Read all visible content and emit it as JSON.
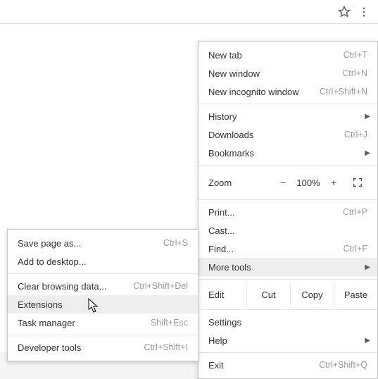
{
  "toolbar": {
    "star_icon": "star-icon",
    "menu_icon": "kebab-menu-icon"
  },
  "menu": {
    "new_tab": {
      "label": "New tab",
      "shortcut": "Ctrl+T"
    },
    "new_window": {
      "label": "New window",
      "shortcut": "Ctrl+N"
    },
    "new_incognito": {
      "label": "New incognito window",
      "shortcut": "Ctrl+Shift+N"
    },
    "history": {
      "label": "History"
    },
    "downloads": {
      "label": "Downloads",
      "shortcut": "Ctrl+J"
    },
    "bookmarks": {
      "label": "Bookmarks"
    },
    "zoom": {
      "label": "Zoom",
      "minus": "−",
      "pct": "100%",
      "plus": "+"
    },
    "print": {
      "label": "Print...",
      "shortcut": "Ctrl+P"
    },
    "cast": {
      "label": "Cast..."
    },
    "find": {
      "label": "Find...",
      "shortcut": "Ctrl+F"
    },
    "more_tools": {
      "label": "More tools"
    },
    "edit": {
      "label": "Edit",
      "cut": "Cut",
      "copy": "Copy",
      "paste": "Paste"
    },
    "settings": {
      "label": "Settings"
    },
    "help": {
      "label": "Help"
    },
    "exit": {
      "label": "Exit",
      "shortcut": "Ctrl+Shift+Q"
    }
  },
  "submenu": {
    "save_page_as": {
      "label": "Save page as...",
      "shortcut": "Ctrl+S"
    },
    "add_to_desktop": {
      "label": "Add to desktop..."
    },
    "clear_browsing_data": {
      "label": "Clear browsing data...",
      "shortcut": "Ctrl+Shift+Del"
    },
    "extensions": {
      "label": "Extensions"
    },
    "task_manager": {
      "label": "Task manager",
      "shortcut": "Shift+Esc"
    },
    "developer_tools": {
      "label": "Developer tools",
      "shortcut": "Ctrl+Shift+I"
    }
  }
}
